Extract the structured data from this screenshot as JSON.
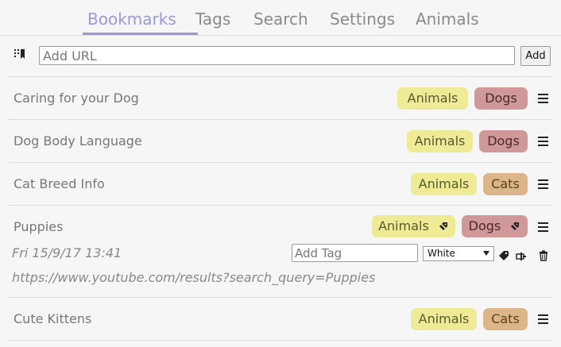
{
  "tabs": [
    {
      "label": "Bookmarks",
      "active": true
    },
    {
      "label": "Tags"
    },
    {
      "label": "Search"
    },
    {
      "label": "Settings"
    },
    {
      "label": "Animals"
    }
  ],
  "url_bar": {
    "placeholder": "Add URL",
    "add_label": "Add"
  },
  "bookmarks": [
    {
      "title": "Caring for your Dog",
      "tags": [
        "Animals",
        "Dogs"
      ]
    },
    {
      "title": "Dog Body Language",
      "tags": [
        "Animals",
        "Dogs"
      ]
    },
    {
      "title": "Cat Breed Info",
      "tags": [
        "Animals",
        "Cats"
      ]
    },
    {
      "title": "Puppies",
      "tags": [
        "Animals",
        "Dogs"
      ],
      "expanded": true,
      "date": "Fri 15/9/17 13:41",
      "url": "https://www.youtube.com/results?search_query=Puppies",
      "tag_input_placeholder": "Add Tag",
      "color_selected": "White"
    },
    {
      "title": "Cute Kittens",
      "tags": [
        "Animals",
        "Cats"
      ]
    }
  ],
  "colors": {
    "accent": "#9b98d6",
    "yellow_tag": "#eeea96",
    "red_tag": "#d09898",
    "tan_tag": "#dcb688"
  },
  "icons": [
    "bookmark-icon",
    "menu-icon",
    "tag-remove-icon",
    "tag-icon",
    "edit-icon",
    "trash-icon"
  ]
}
